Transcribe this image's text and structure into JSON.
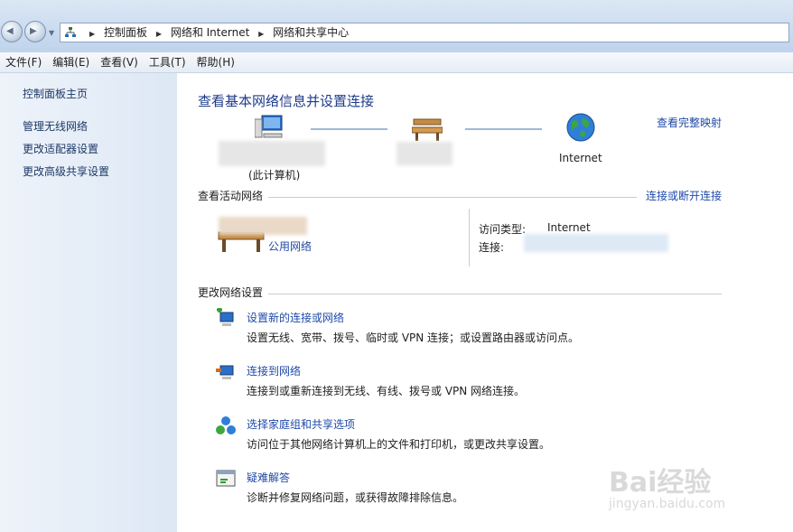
{
  "breadcrumb": {
    "items": [
      "控制面板",
      "网络和 Internet",
      "网络和共享中心"
    ]
  },
  "menu": [
    "文件(F)",
    "编辑(E)",
    "查看(V)",
    "工具(T)",
    "帮助(H)"
  ],
  "sidebar": {
    "items": [
      "控制面板主页",
      "管理无线网络",
      "更改适配器设置",
      "更改高级共享设置"
    ]
  },
  "main": {
    "title": "查看基本网络信息并设置连接",
    "full_map_link": "查看完整映射",
    "map": {
      "this_pc_label": "(此计算机)",
      "internet_label": "Internet"
    },
    "active": {
      "header": "查看活动网络",
      "connect_link": "连接或断开连接",
      "network_type": "公用网络",
      "access_type_label": "访问类型:",
      "access_type_value": "Internet",
      "connection_label": "连接:"
    },
    "change": {
      "header": "更改网络设置",
      "options": [
        {
          "title": "设置新的连接或网络",
          "desc": "设置无线、宽带、拨号、临时或 VPN 连接；或设置路由器或访问点。"
        },
        {
          "title": "连接到网络",
          "desc": "连接到或重新连接到无线、有线、拨号或 VPN 网络连接。"
        },
        {
          "title": "选择家庭组和共享选项",
          "desc": "访问位于其他网络计算机上的文件和打印机，或更改共享设置。"
        },
        {
          "title": "疑难解答",
          "desc": "诊断并修复网络问题，或获得故障排除信息。"
        }
      ]
    }
  },
  "watermark": {
    "text": "Bai经验",
    "url_text": "jingyan.baidu.com"
  }
}
